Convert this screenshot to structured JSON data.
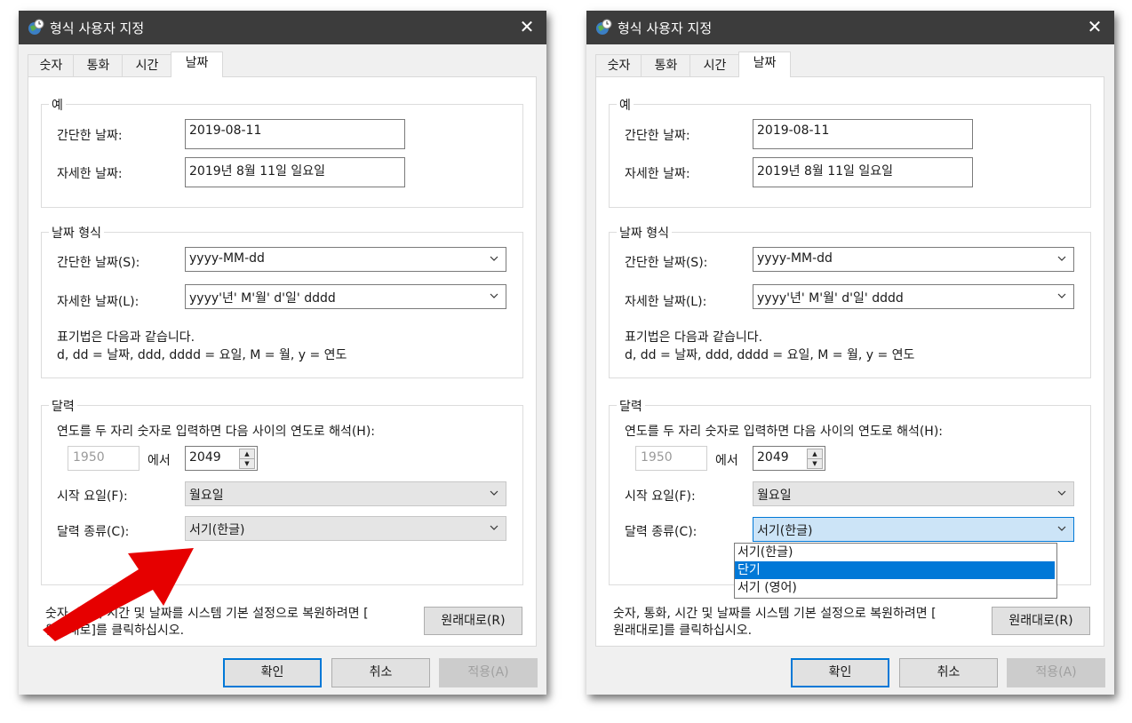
{
  "dialog": {
    "title": "형식 사용자 지정",
    "tabs": [
      "숫자",
      "통화",
      "시간",
      "날짜"
    ],
    "example": {
      "title": "예",
      "short_label": "간단한 날짜:",
      "short_value": "2019-08-11",
      "long_label": "자세한 날짜:",
      "long_value": "2019년 8월 11일 일요일"
    },
    "format": {
      "title": "날짜 형식",
      "short_label": "간단한 날짜(S):",
      "short_value": "yyyy-MM-dd",
      "long_label": "자세한 날짜(L):",
      "long_value": "yyyy'년' M'월' d'일' dddd",
      "notation_line1": "표기법은 다음과 같습니다.",
      "notation_line2": "d, dd = 날짜,  ddd, dddd = 요일,  M = 월,  y = 연도"
    },
    "calendar": {
      "title": "달력",
      "twodigit_label": "연도를 두 자리 숫자로 입력하면 다음 사이의 연도로 해석(H):",
      "year_from": "1950",
      "between_label": "에서",
      "year_to": "2049",
      "first_day_label": "시작 요일(F):",
      "first_day_value": "월요일",
      "type_label": "달력 종류(C):",
      "type_value": "서기(한글)"
    },
    "reset_text_1": "숫자, 통화, 시간 및 날짜를 시스템 기본 설정으로 복원하려면 [",
    "reset_text_2": "원래대로]를 클릭하십시오.",
    "reset_button": "원래대로(R)",
    "ok_button": "확인",
    "cancel_button": "취소",
    "apply_button": "적용(A)"
  },
  "dropdown_options": [
    "서기(한글)",
    "단기",
    "서기 (영어)"
  ],
  "dropdown_selected_index": 1,
  "colors": {
    "titlebar": "#3c3c3c",
    "accent": "#0078d7",
    "arrow": "#e60000",
    "open_combo": "#cce4f7"
  },
  "icons": [
    "globe-clock-icon",
    "close-icon",
    "chevron-down-icon",
    "spin-up-icon",
    "spin-down-icon",
    "red-arrow"
  ]
}
